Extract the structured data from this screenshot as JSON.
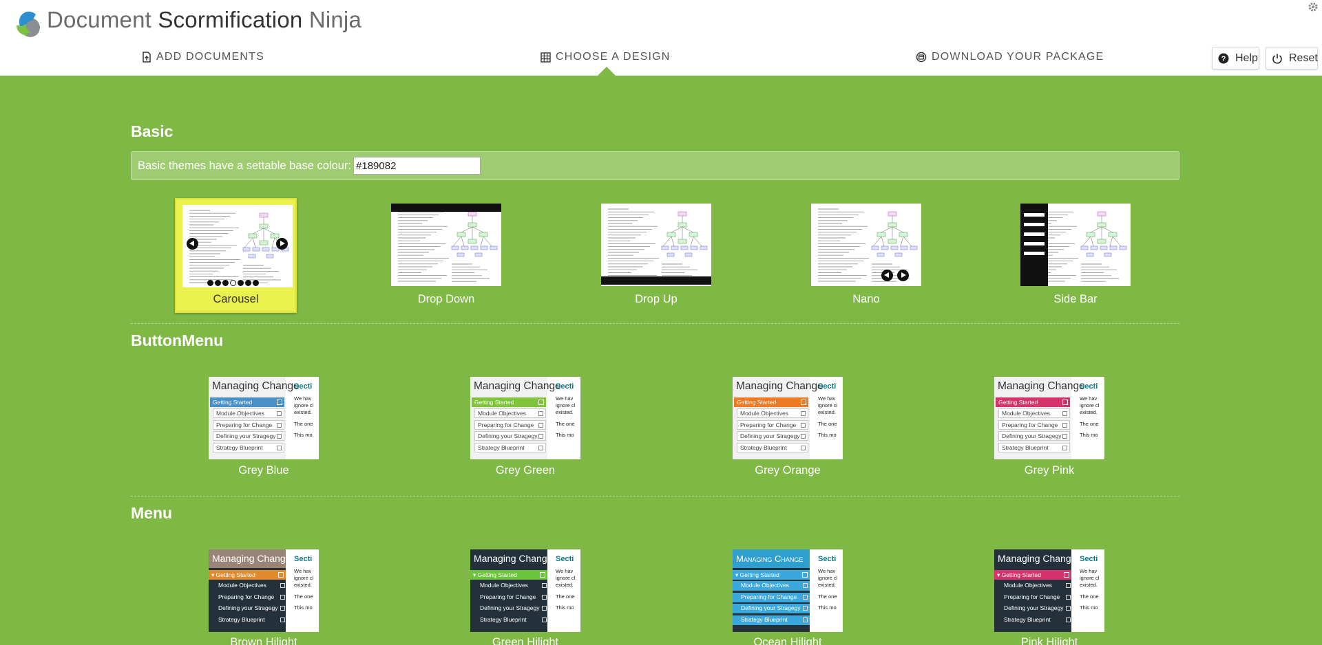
{
  "app": {
    "title_part1": "Document",
    "title_part2": "Scormification",
    "title_part3": "Ninja"
  },
  "nav": {
    "tabs": [
      {
        "label": "ADD DOCUMENTS",
        "icon": "file-upload-icon"
      },
      {
        "label": "CHOOSE A DESIGN",
        "icon": "grid-icon",
        "active": true
      },
      {
        "label": "DOWNLOAD YOUR PACKAGE",
        "icon": "download-circle-icon"
      }
    ],
    "help_label": "Help",
    "reset_label": "Reset"
  },
  "colors": {
    "background": "#7fb844",
    "selected": "#eaf04d",
    "grey_blue": "#4a90c8",
    "grey_green": "#7fc43b",
    "grey_orange": "#f07a22",
    "grey_pink": "#d6336c",
    "brown_hilight": "#e08a2e",
    "green_hilight": "#6cc43a",
    "ocean_hilight": "#3aa8dc",
    "pink_hilight": "#d6336c"
  },
  "basic": {
    "title": "Basic",
    "colour_prompt": "Basic themes have a settable base colour:",
    "colour_value": "#189082",
    "themes": [
      {
        "label": "Carousel",
        "selected": true
      },
      {
        "label": "Drop Down"
      },
      {
        "label": "Drop Up"
      },
      {
        "label": "Nano"
      },
      {
        "label": "Side Bar"
      }
    ]
  },
  "button_menu": {
    "title": "ButtonMenu",
    "themes": [
      {
        "label": "Grey Blue"
      },
      {
        "label": "Grey Green"
      },
      {
        "label": "Grey Orange"
      },
      {
        "label": "Grey Pink"
      }
    ]
  },
  "menu": {
    "title": "Menu",
    "themes": [
      {
        "label": "Brown Hilight"
      },
      {
        "label": "Green Hilight"
      },
      {
        "label": "Ocean Hilight"
      },
      {
        "label": "Pink Hilight"
      }
    ]
  },
  "thumb_text": {
    "heading": "Managing Change",
    "active_item": "Getting Started",
    "active_item_expanded": "▾ Getting Started",
    "items": [
      "Module Objectives",
      "Preparing for Change",
      "Defining your Stragegy",
      "Strategy Blueprint"
    ],
    "section": "Secti",
    "lines": [
      "We hav",
      "ignore cl",
      "existed.",
      "The one",
      "This mo"
    ]
  }
}
